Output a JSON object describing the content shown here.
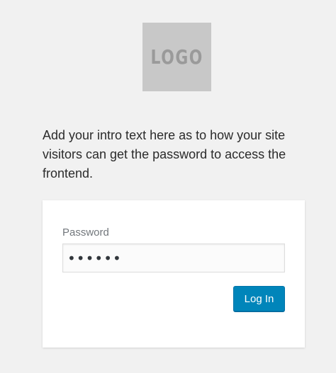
{
  "logo": {
    "text": "LOGO"
  },
  "intro": {
    "text": "Add your intro text here as to how your site visitors can get the password to access the frontend."
  },
  "form": {
    "password_label": "Password",
    "password_value": "••••••",
    "login_button_label": "Log In"
  },
  "colors": {
    "background": "#f1f1f1",
    "card": "#ffffff",
    "button": "#0085ba",
    "logo_box": "#c8c8c8"
  }
}
